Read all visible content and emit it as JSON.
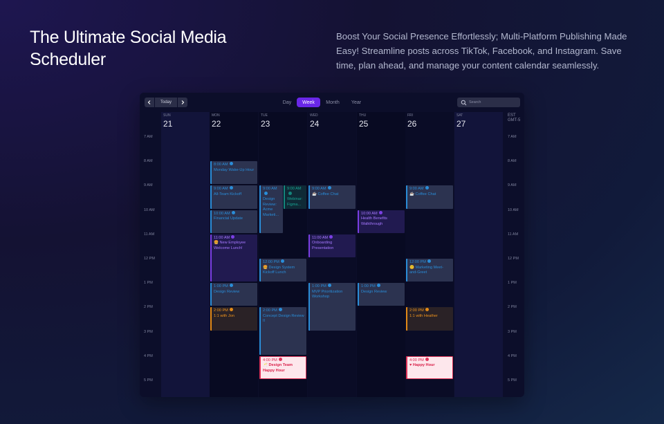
{
  "headline": "The Ultimate Social Media Scheduler",
  "subtext": "Boost Your Social Presence Effortlessly; Multi-Platform Publishing Made Easy! Streamline posts across TikTok, Facebook, and Instagram. Save time, plan ahead, and manage your content calendar seamlessly.",
  "toolbar": {
    "prev_icon": "chevron-left-icon",
    "next_icon": "chevron-right-icon",
    "today_label": "Today",
    "views": [
      "Day",
      "Week",
      "Month",
      "Year"
    ],
    "active_view": "Week",
    "search_placeholder": "Search",
    "search_icon": "search-icon"
  },
  "timezone": {
    "abbr": "EST",
    "offset": "GMT-5"
  },
  "days": [
    {
      "name": "SUN",
      "date": "21"
    },
    {
      "name": "MON",
      "date": "22"
    },
    {
      "name": "TUE",
      "date": "23"
    },
    {
      "name": "WED",
      "date": "24"
    },
    {
      "name": "THU",
      "date": "25"
    },
    {
      "name": "FRI",
      "date": "26"
    },
    {
      "name": "SAT",
      "date": "27"
    }
  ],
  "hours": [
    "7 AM",
    "8 AM",
    "9 AM",
    "10 AM",
    "11 AM",
    "12 PM",
    "1 PM",
    "2 PM",
    "3 PM",
    "4 PM",
    "5 PM"
  ],
  "events": [
    {
      "day": 1,
      "start": 8,
      "end": 9,
      "time": "8:00 AM",
      "title": "Monday Wake-Up Hour",
      "color": "blue"
    },
    {
      "day": 1,
      "start": 9,
      "end": 10,
      "time": "9:00 AM",
      "title": "All-Team Kickoff",
      "color": "blue"
    },
    {
      "day": 1,
      "start": 10,
      "end": 11,
      "time": "10:00 AM",
      "title": "Financial Update",
      "color": "blue"
    },
    {
      "day": 1,
      "start": 11,
      "end": 13,
      "time": "11:00 AM",
      "title": "🍔 New Employee Welcome Lunch!",
      "color": "purple"
    },
    {
      "day": 1,
      "start": 13,
      "end": 14,
      "time": "1:00 PM",
      "title": "Design Review",
      "color": "blue"
    },
    {
      "day": 1,
      "start": 14,
      "end": 15,
      "time": "2:00 PM",
      "title": "1:1 with Jon",
      "color": "orange"
    },
    {
      "day": 2,
      "start": 9,
      "end": 11,
      "time": "9:00 AM",
      "title": "Design Review: Acme Marketi...",
      "color": "blue",
      "half": "left"
    },
    {
      "day": 2,
      "start": 9,
      "end": 10,
      "time": "9:00 AM",
      "title": "Webinar: Figma...",
      "color": "teal",
      "half": "right"
    },
    {
      "day": 2,
      "start": 12,
      "end": 13,
      "time": "12:00 PM",
      "title": "🍔 Design System Kickoff Lunch",
      "color": "blue"
    },
    {
      "day": 2,
      "start": 14,
      "end": 16,
      "time": "2:00 PM",
      "title": "Concept Design Review II",
      "color": "blue"
    },
    {
      "day": 2,
      "start": 16,
      "end": 17,
      "time": "4:00 PM",
      "title": "🥂 Design Team Happy Hour",
      "color": "pink"
    },
    {
      "day": 3,
      "start": 9,
      "end": 10,
      "time": "9:00 AM",
      "title": "☕ Coffee Chat",
      "color": "blue"
    },
    {
      "day": 3,
      "start": 11,
      "end": 12,
      "time": "11:00 AM",
      "title": "Onboarding Presentation",
      "color": "purple"
    },
    {
      "day": 3,
      "start": 13,
      "end": 15,
      "time": "1:00 PM",
      "title": "MVP Prioritization Workshop",
      "color": "blue"
    },
    {
      "day": 4,
      "start": 10,
      "end": 11,
      "time": "10:00 AM",
      "title": "Health Benefits Walkthrough",
      "color": "purple"
    },
    {
      "day": 4,
      "start": 13,
      "end": 14,
      "time": "1:00 PM",
      "title": "Design Review",
      "color": "blue"
    },
    {
      "day": 5,
      "start": 9,
      "end": 10,
      "time": "9:00 AM",
      "title": "☕ Coffee Chat",
      "color": "blue"
    },
    {
      "day": 5,
      "start": 12,
      "end": 13,
      "time": "12:00 PM",
      "title": "😊 Marketing Meet-and-Greet",
      "color": "blue"
    },
    {
      "day": 5,
      "start": 14,
      "end": 15,
      "time": "2:00 PM",
      "title": "1:1 with Heather",
      "color": "orange"
    },
    {
      "day": 5,
      "start": 16,
      "end": 17,
      "time": "4:00 PM",
      "title": "♥ Happy Hour",
      "color": "pink"
    }
  ],
  "colors": {
    "accent": "#6a27e8",
    "blue": "#2a8dd8",
    "purple": "#7b3fe4",
    "orange": "#e38a17",
    "teal": "#14867c",
    "pink": "#e0345a"
  }
}
